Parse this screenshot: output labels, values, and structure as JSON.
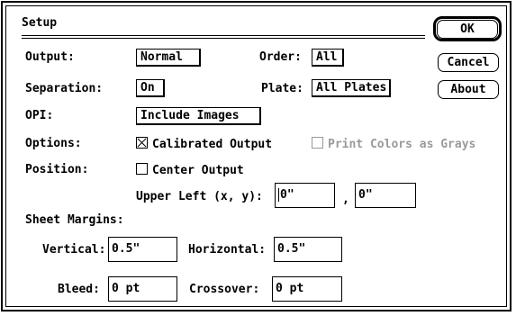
{
  "dialog": {
    "title": "Setup",
    "buttons": {
      "ok": "OK",
      "cancel": "Cancel",
      "about": "About"
    },
    "output": {
      "label": "Output:",
      "value": "Normal"
    },
    "order": {
      "label": "Order:",
      "value": "All"
    },
    "separation": {
      "label": "Separation:",
      "value": "On"
    },
    "plate": {
      "label": "Plate:",
      "value": "All Plates"
    },
    "opi": {
      "label": "OPI:",
      "value": "Include Images"
    },
    "options": {
      "label": "Options:",
      "calibrated_output": {
        "label": "Calibrated Output",
        "checked": true
      },
      "print_colors_as_grays": {
        "label": "Print Colors as Grays",
        "checked": false,
        "enabled": false
      }
    },
    "position": {
      "label": "Position:",
      "center_output": {
        "label": "Center Output",
        "checked": false
      },
      "upper_left_label": "Upper Left (x, y):",
      "x_value": "0\"",
      "comma": ",",
      "y_value": "0\""
    },
    "sheet_margins": {
      "label": "Sheet Margins:",
      "vertical_label": "Vertical:",
      "vertical_value": "0.5\"",
      "horizontal_label": "Horizontal:",
      "horizontal_value": "0.5\"",
      "bleed_label": "Bleed:",
      "bleed_value": "0 pt",
      "crossover_label": "Crossover:",
      "crossover_value": "0 pt"
    }
  },
  "colors": {
    "disabled_text": "#9a9a9a",
    "border": "#000000",
    "background": "#ffffff"
  }
}
